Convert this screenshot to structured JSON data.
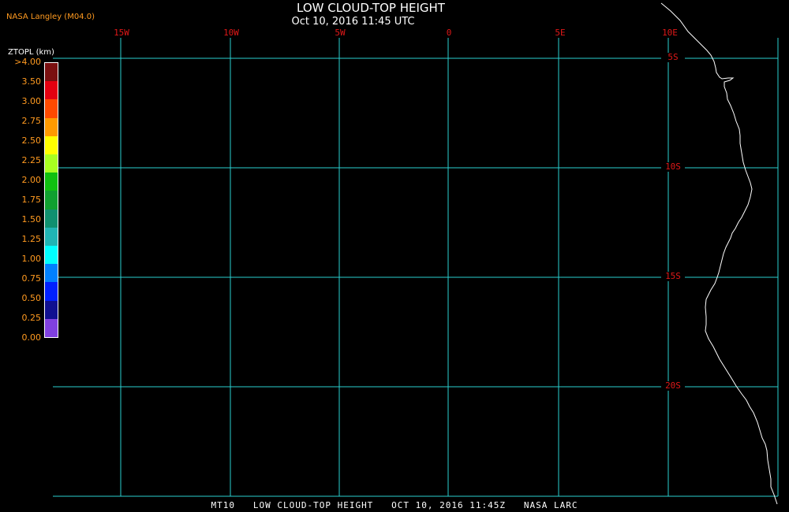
{
  "header": {
    "credit": "NASA Langley (M04.0)",
    "title": "LOW CLOUD-TOP HEIGHT",
    "subtitle": "Oct 10, 2016 11:45 UTC"
  },
  "map": {
    "lon_labels": [
      "15W",
      "10W",
      "5W",
      "0",
      "5E",
      "10E"
    ],
    "lat_labels": [
      "5S",
      "10S",
      "15S",
      "20S"
    ],
    "colors": {
      "grid": "#2ad0d0",
      "label": "#e01818",
      "coast": "#ffffff",
      "background": "#000000"
    }
  },
  "legend": {
    "title": "ZTOPL (km)",
    "ticks": [
      ">4.00",
      "3.50",
      "3.00",
      "2.75",
      "2.50",
      "2.25",
      "2.00",
      "1.75",
      "1.50",
      "1.25",
      "1.00",
      "0.75",
      "0.50",
      "0.25",
      "0.00"
    ],
    "colors": [
      "#7a1010",
      "#e40010",
      "#ff4a00",
      "#ff9a00",
      "#ffff00",
      "#a8ff20",
      "#10c010",
      "#10a030",
      "#109070",
      "#20b4b4",
      "#00ffff",
      "#0080ff",
      "#0020ff",
      "#101090",
      "#8040e0"
    ]
  },
  "footer": {
    "text": "MT10   LOW CLOUD-TOP HEIGHT   OCT 10, 2016 11:45Z   NASA LARC"
  }
}
